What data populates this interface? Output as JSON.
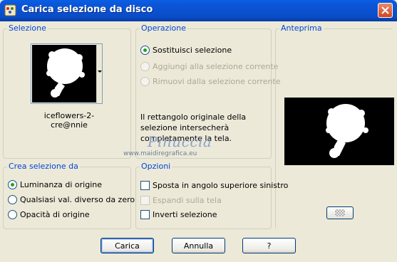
{
  "window": {
    "title": "Carica selezione da disco",
    "accent": "#0a5fe4"
  },
  "icons": {
    "app": "app-palette-icon",
    "close": "close-icon"
  },
  "selezione": {
    "label": "Selezione",
    "file_name": "iceflowers-2-cre@nnie"
  },
  "operazione": {
    "label": "Operazione",
    "options": [
      {
        "label": "Sostituisci selezione",
        "checked": true,
        "enabled": true
      },
      {
        "label": "Aggiungi alla selezione corrente",
        "checked": false,
        "enabled": false
      },
      {
        "label": "Rimuovi dalla selezione corrente",
        "checked": false,
        "enabled": false
      }
    ],
    "note": "Il rettangolo originale della selezione intersecherà completamente la tela."
  },
  "anteprima": {
    "label": "Anteprima"
  },
  "crea": {
    "label": "Crea selezione da",
    "options": [
      {
        "label": "Luminanza di origine",
        "checked": true
      },
      {
        "label": "Qualsiasi val. diverso da zero",
        "checked": false
      },
      {
        "label": "Opacità di origine",
        "checked": false
      }
    ]
  },
  "opzioni": {
    "label": "Opzioni",
    "items": [
      {
        "label": "Sposta in angolo superiore sinistro",
        "checked": false,
        "enabled": true
      },
      {
        "label": "Espandi sulla tela",
        "checked": false,
        "enabled": false
      },
      {
        "label": "Inverti selezione",
        "checked": false,
        "enabled": true
      }
    ]
  },
  "watermark": {
    "name": "Pinuccia",
    "site": "www.maidiregrafica.eu"
  },
  "buttons": {
    "carica": "Carica",
    "annulla": "Annulla",
    "help": "?"
  }
}
